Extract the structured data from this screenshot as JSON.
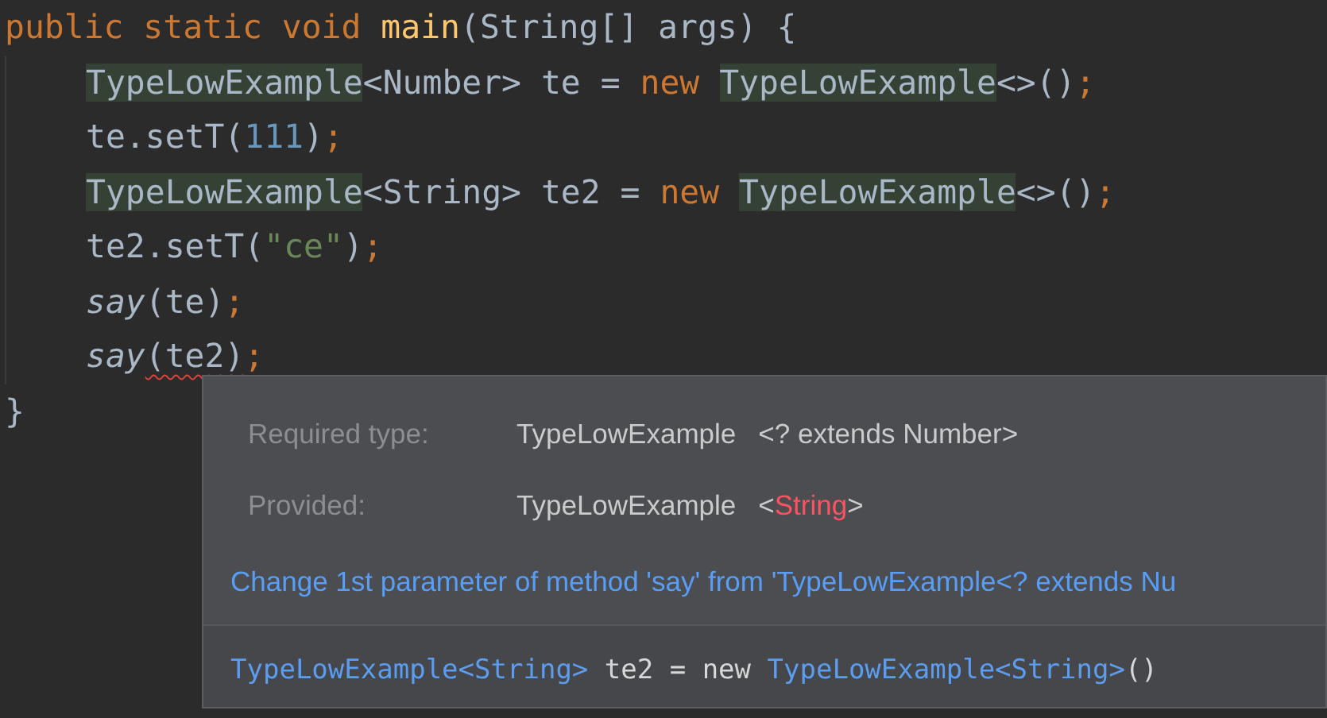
{
  "code_lines": [
    {
      "tokens": [
        {
          "kind": "keyword",
          "text": "public static void "
        },
        {
          "kind": "declaration",
          "text": "main"
        },
        {
          "kind": "plain",
          "text": "(String[] args) {"
        }
      ],
      "children": [
        {
          "tokens": [
            {
              "kind": "highlighted",
              "text": "TypeLowExample"
            },
            {
              "kind": "plain",
              "text": "<Number> te = "
            },
            {
              "kind": "keyword",
              "text": "new "
            },
            {
              "kind": "highlighted",
              "text": "TypeLowExample"
            },
            {
              "kind": "plain",
              "text": "<>()"
            },
            {
              "kind": "keyword",
              "text": ";"
            }
          ]
        },
        {
          "tokens": [
            {
              "kind": "plain",
              "text": "te.setT("
            },
            {
              "kind": "number",
              "text": "111"
            },
            {
              "kind": "plain",
              "text": ")"
            },
            {
              "kind": "keyword",
              "text": ";"
            }
          ]
        },
        {
          "tokens": [
            {
              "kind": "highlighted",
              "text": "TypeLowExample"
            },
            {
              "kind": "plain",
              "text": "<String> te2 = "
            },
            {
              "kind": "keyword",
              "text": "new "
            },
            {
              "kind": "highlighted",
              "text": "TypeLowExample"
            },
            {
              "kind": "plain",
              "text": "<>()"
            },
            {
              "kind": "keyword",
              "text": ";"
            }
          ]
        },
        {
          "tokens": [
            {
              "kind": "plain",
              "text": "te2.setT("
            },
            {
              "kind": "string",
              "text": "\"ce\""
            },
            {
              "kind": "plain",
              "text": ")"
            },
            {
              "kind": "keyword",
              "text": ";"
            }
          ]
        },
        {
          "tokens": [
            {
              "kind": "static_call",
              "text": "say"
            },
            {
              "kind": "plain",
              "text": "(te)"
            },
            {
              "kind": "keyword",
              "text": ";"
            }
          ]
        },
        {
          "tokens": [
            {
              "kind": "static_call",
              "text": "say"
            },
            {
              "kind": "error",
              "text": "(te2)"
            },
            {
              "kind": "keyword",
              "text": ";"
            }
          ]
        }
      ]
    },
    {
      "tokens": [
        {
          "kind": "plain",
          "text": "}"
        }
      ]
    }
  ],
  "tooltip": {
    "rows": [
      {
        "label": "Required type:",
        "type_name": "TypeLowExample",
        "type_args": [
          {
            "text": "<? extends Number>",
            "error": false
          }
        ]
      },
      {
        "label": "Provided:",
        "type_name": "TypeLowExample",
        "type_args": [
          {
            "text": "<",
            "error": false
          },
          {
            "text": "String",
            "error": true
          },
          {
            "text": ">",
            "error": false
          }
        ]
      }
    ],
    "fix_link": "Change 1st parameter of method 'say' from 'TypeLowExample<? extends Nu",
    "suggestion": [
      {
        "kind": "type",
        "text": "TypeLowExample<String>"
      },
      {
        "kind": "plain",
        "text": " te2 = new "
      },
      {
        "kind": "type",
        "text": "TypeLowExample<String>"
      },
      {
        "kind": "plain",
        "text": "()"
      }
    ]
  }
}
